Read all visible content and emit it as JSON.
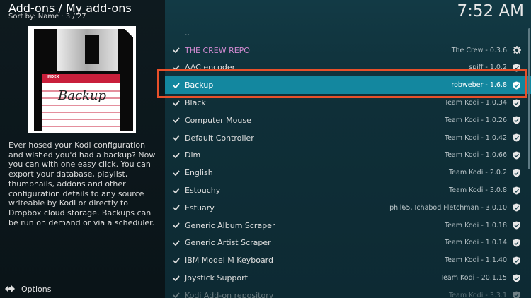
{
  "header": {
    "title": "Add-ons / My add-ons",
    "sort": "Sort by: Name  ·  3 / 27",
    "clock": "7:52 AM"
  },
  "preview": {
    "disk_index_label": "INDEX",
    "disk_label": "Backup",
    "description": "Ever hosed your Kodi configuration and wished you'd had a backup? Now you can with one easy click. You can export your database, playlist, thumbnails, addons and other configuration details to any source writeable by Kodi or directly to Dropbox cloud storage. Backups can be run on demand or via a scheduler."
  },
  "footer": {
    "options_label": "Options"
  },
  "list": {
    "parent": "..",
    "items": [
      {
        "name": "THE CREW REPO",
        "version": "The Crew - 0.3.6"
      },
      {
        "name": "AAC encoder",
        "version": "spiff - 1.0.2"
      },
      {
        "name": "Backup",
        "version": "robweber - 1.6.8"
      },
      {
        "name": "Black",
        "version": "Team Kodi - 1.0.34"
      },
      {
        "name": "Computer Mouse",
        "version": "Team Kodi - 1.0.26"
      },
      {
        "name": "Default Controller",
        "version": "Team Kodi - 1.0.42"
      },
      {
        "name": "Dim",
        "version": "Team Kodi - 1.0.66"
      },
      {
        "name": "English",
        "version": "Team Kodi - 2.0.2"
      },
      {
        "name": "Estouchy",
        "version": "Team Kodi - 3.0.8"
      },
      {
        "name": "Estuary",
        "version": "phil65, Ichabod Fletchman - 3.0.10"
      },
      {
        "name": "Generic Album Scraper",
        "version": "Team Kodi - 1.0.18"
      },
      {
        "name": "Generic Artist Scraper",
        "version": "Team Kodi - 1.0.14"
      },
      {
        "name": "IBM Model M Keyboard",
        "version": "Team Kodi - 1.1.40"
      },
      {
        "name": "Joystick Support",
        "version": "Team Kodi - 20.1.15"
      },
      {
        "name": "Kodi Add-on repository",
        "version": "Team Kodi - 3.3.1"
      }
    ]
  },
  "colors": {
    "focus_bar": "#13879f",
    "focus_outline": "#e8502a",
    "crew_text": "#d08ad0"
  }
}
